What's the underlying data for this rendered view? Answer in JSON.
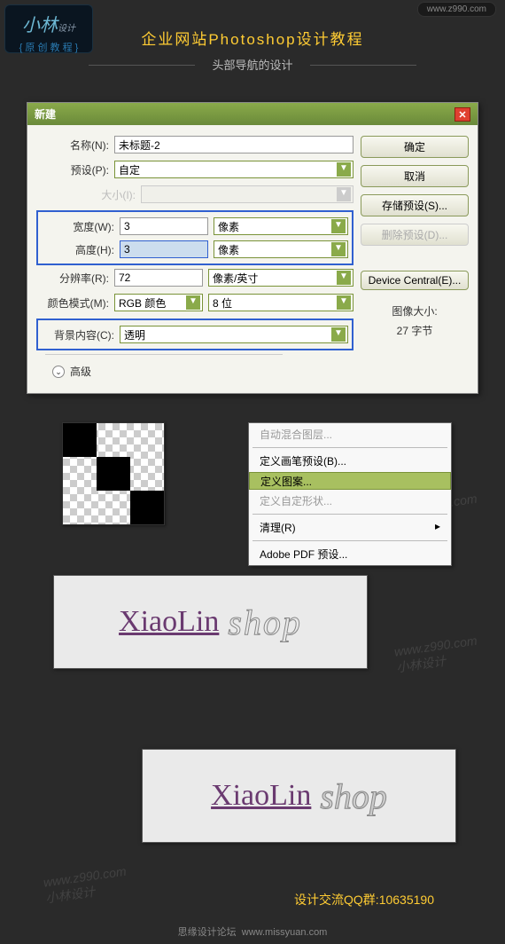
{
  "header": {
    "logo_main": "小林",
    "logo_small": "设计",
    "logo_sub": "{ 原 创 教 程 }",
    "url_pill": "www.z990.com",
    "title_main": "企业网站Photoshop设计教程",
    "title_sub": "头部导航的设计"
  },
  "dialog": {
    "title": "新建",
    "name_label": "名称(N):",
    "name_value": "未标题-2",
    "preset_label": "预设(P):",
    "preset_value": "自定",
    "size_label": "大小(I):",
    "width_label": "宽度(W):",
    "width_value": "3",
    "width_unit": "像素",
    "height_label": "高度(H):",
    "height_value": "3",
    "height_unit": "像素",
    "res_label": "分辨率(R):",
    "res_value": "72",
    "res_unit": "像素/英寸",
    "mode_label": "颜色模式(M):",
    "mode_value": "RGB 颜色",
    "mode_bits": "8 位",
    "bg_label": "背景内容(C):",
    "bg_value": "透明",
    "advanced": "高级",
    "btn_ok": "确定",
    "btn_cancel": "取消",
    "btn_save": "存储预设(S)...",
    "btn_delete": "删除预设(D)...",
    "btn_device": "Device Central(E)...",
    "info_label": "图像大小:",
    "info_value": "27 字节"
  },
  "menu": {
    "i1": "自动混合图层...",
    "i2": "定义画笔预设(B)...",
    "i3": "定义图案...",
    "i4": "定义自定形状...",
    "i5": "清理(R)",
    "i6": "Adobe PDF 预设..."
  },
  "preview": {
    "brand": "XiaoLin",
    "word": "shop"
  },
  "footer": {
    "qq": "设计交流QQ群:10635190",
    "forum": "思缘设计论坛",
    "forum_url": "www.missyuan.com"
  }
}
